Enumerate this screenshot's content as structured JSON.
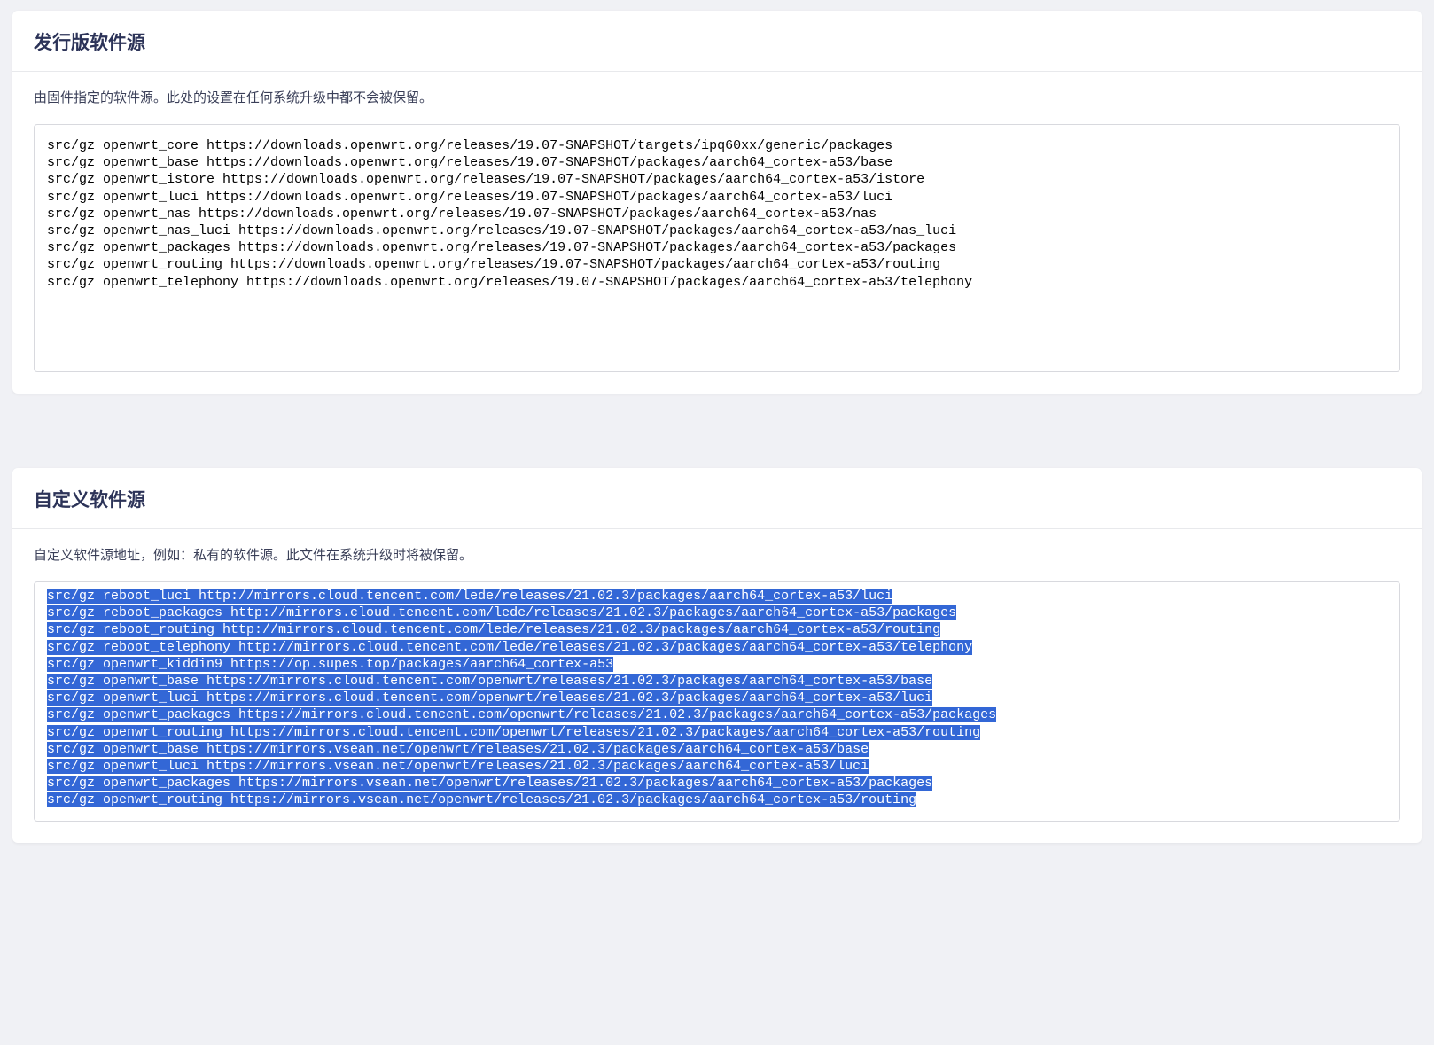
{
  "distroFeeds": {
    "title": "发行版软件源",
    "description": "由固件指定的软件源。此处的设置在任何系统升级中都不会被保留。",
    "lines": [
      "src/gz openwrt_core https://downloads.openwrt.org/releases/19.07-SNAPSHOT/targets/ipq60xx/generic/packages",
      "src/gz openwrt_base https://downloads.openwrt.org/releases/19.07-SNAPSHOT/packages/aarch64_cortex-a53/base",
      "src/gz openwrt_istore https://downloads.openwrt.org/releases/19.07-SNAPSHOT/packages/aarch64_cortex-a53/istore",
      "src/gz openwrt_luci https://downloads.openwrt.org/releases/19.07-SNAPSHOT/packages/aarch64_cortex-a53/luci",
      "src/gz openwrt_nas https://downloads.openwrt.org/releases/19.07-SNAPSHOT/packages/aarch64_cortex-a53/nas",
      "src/gz openwrt_nas_luci https://downloads.openwrt.org/releases/19.07-SNAPSHOT/packages/aarch64_cortex-a53/nas_luci",
      "src/gz openwrt_packages https://downloads.openwrt.org/releases/19.07-SNAPSHOT/packages/aarch64_cortex-a53/packages",
      "src/gz openwrt_routing https://downloads.openwrt.org/releases/19.07-SNAPSHOT/packages/aarch64_cortex-a53/routing",
      "src/gz openwrt_telephony https://downloads.openwrt.org/releases/19.07-SNAPSHOT/packages/aarch64_cortex-a53/telephony"
    ]
  },
  "customFeeds": {
    "title": "自定义软件源",
    "description": "自定义软件源地址，例如：私有的软件源。此文件在系统升级时将被保留。",
    "lines": [
      "src/gz reboot_luci http://mirrors.cloud.tencent.com/lede/releases/21.02.3/packages/aarch64_cortex-a53/luci",
      "src/gz reboot_packages http://mirrors.cloud.tencent.com/lede/releases/21.02.3/packages/aarch64_cortex-a53/packages",
      "src/gz reboot_routing http://mirrors.cloud.tencent.com/lede/releases/21.02.3/packages/aarch64_cortex-a53/routing",
      "src/gz reboot_telephony http://mirrors.cloud.tencent.com/lede/releases/21.02.3/packages/aarch64_cortex-a53/telephony",
      "src/gz openwrt_kiddin9 https://op.supes.top/packages/aarch64_cortex-a53",
      "src/gz openwrt_base https://mirrors.cloud.tencent.com/openwrt/releases/21.02.3/packages/aarch64_cortex-a53/base",
      "src/gz openwrt_luci https://mirrors.cloud.tencent.com/openwrt/releases/21.02.3/packages/aarch64_cortex-a53/luci",
      "src/gz openwrt_packages https://mirrors.cloud.tencent.com/openwrt/releases/21.02.3/packages/aarch64_cortex-a53/packages",
      "src/gz openwrt_routing https://mirrors.cloud.tencent.com/openwrt/releases/21.02.3/packages/aarch64_cortex-a53/routing",
      "src/gz openwrt_base https://mirrors.vsean.net/openwrt/releases/21.02.3/packages/aarch64_cortex-a53/base",
      "src/gz openwrt_luci https://mirrors.vsean.net/openwrt/releases/21.02.3/packages/aarch64_cortex-a53/luci",
      "src/gz openwrt_packages https://mirrors.vsean.net/openwrt/releases/21.02.3/packages/aarch64_cortex-a53/packages",
      "src/gz openwrt_routing https://mirrors.vsean.net/openwrt/releases/21.02.3/packages/aarch64_cortex-a53/routing"
    ]
  }
}
